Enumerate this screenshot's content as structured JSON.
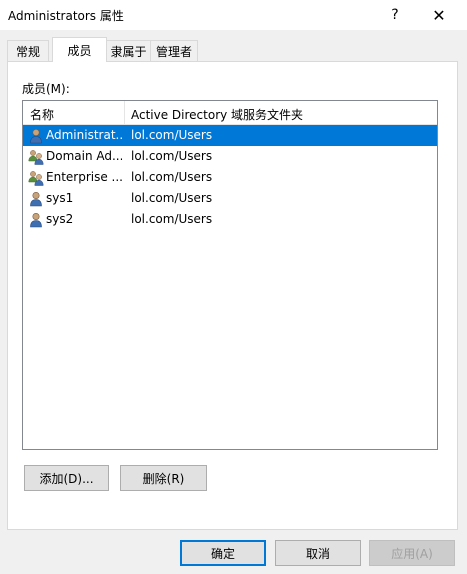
{
  "window": {
    "title": "Administrators 属性",
    "help_glyph": "?",
    "close_glyph": "✕"
  },
  "tabs": [
    {
      "label": "常规",
      "active": false
    },
    {
      "label": "成员",
      "active": true
    },
    {
      "label": "隶属于",
      "active": false
    },
    {
      "label": "管理者",
      "active": false
    }
  ],
  "members": {
    "label": "成员(M):",
    "columns": {
      "name": "名称",
      "folder": "Active Directory 域服务文件夹"
    },
    "rows": [
      {
        "name": "Administrat...",
        "folder": "lol.com/Users",
        "icon": "user-icon",
        "selected": true
      },
      {
        "name": "Domain Ad...",
        "folder": "lol.com/Users",
        "icon": "group-icon",
        "selected": false
      },
      {
        "name": "Enterprise ...",
        "folder": "lol.com/Users",
        "icon": "group-icon",
        "selected": false
      },
      {
        "name": "sys1",
        "folder": "lol.com/Users",
        "icon": "user-icon",
        "selected": false
      },
      {
        "name": "sys2",
        "folder": "lol.com/Users",
        "icon": "user-icon",
        "selected": false
      }
    ],
    "add_label": "添加(D)...",
    "remove_label": "删除(R)"
  },
  "footer": {
    "ok_label": "确定",
    "cancel_label": "取消",
    "apply_label": "应用(A)"
  },
  "colors": {
    "selection": "#0078d7",
    "window_bg": "#f0f0f0",
    "panel_bg": "#ffffff"
  }
}
